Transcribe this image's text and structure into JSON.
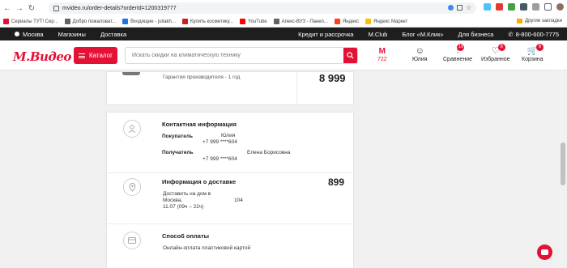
{
  "browser": {
    "url": "mvideo.ru/order-details?orderId=1200319777",
    "bookmarks": [
      {
        "label": "Сериалы ТУТ! Сер...",
        "color": "#e31235"
      },
      {
        "label": "Добро пожаловат...",
        "color": "#5f6368"
      },
      {
        "label": "Входящие - juliakh...",
        "color": "#1a73e8"
      },
      {
        "label": "Купить косметику...",
        "color": "#c5221f"
      },
      {
        "label": "YouTube",
        "color": "#ff0000"
      },
      {
        "label": "Апекс-ВУЗ - Панел...",
        "color": "#5f6368"
      },
      {
        "label": "Яндекс",
        "color": "#fc3f1d"
      },
      {
        "label": "Яндекс Маркет",
        "color": "#fcc100"
      }
    ],
    "other_bookmarks": "Другие закладки"
  },
  "topnav": {
    "city": "Москва",
    "stores": "Магазины",
    "delivery": "Доставка",
    "credit": "Кредит и рассрочка",
    "mclub": "M.Club",
    "blog": "Блог «М.Клик»",
    "business": "Для бизнеса",
    "phone": "8-800-600-7775"
  },
  "header": {
    "logo": "М.Видео",
    "catalog": "Каталог",
    "search_placeholder": "Искать скидки на климатическую технику",
    "mclub_points": "722",
    "profile": "Юлия",
    "compare": "Сравнение",
    "compare_count": "19",
    "favorites": "Избранное",
    "favorites_count": "8",
    "cart": "Корзина",
    "cart_count": "6"
  },
  "order": {
    "warranty": "Гарантия производителя - 1 год",
    "item_price": "8 999"
  },
  "contact": {
    "title": "Контактная информация",
    "buyer_label": "Покупатель",
    "buyer_name": "Юлия",
    "buyer_phone": "+7 999 ****604",
    "recipient_label": "Получатель",
    "recipient_name": "Елена Борисовна",
    "recipient_phone": "+7 999 ****604"
  },
  "delivery": {
    "title": "Информация о доставке",
    "price": "899",
    "line1": "Доставить на дом в",
    "city": "Москва,",
    "house": "104",
    "time": "11.07 (09ч – 22ч)"
  },
  "payment": {
    "title": "Способ оплаты",
    "method": "Онлайн-оплата пластиковой картой"
  },
  "colors": {
    "brand": "#e31235",
    "topnav": "#1e1e1e",
    "background": "#f0f0f0"
  }
}
